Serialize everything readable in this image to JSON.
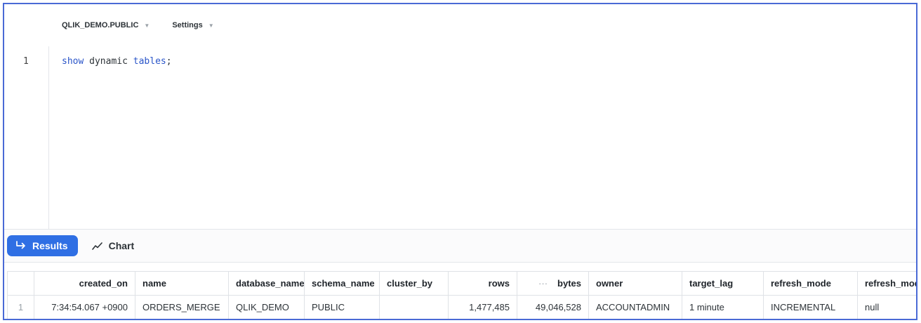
{
  "toolbar": {
    "context": "QLIK_DEMO.PUBLIC",
    "settings": "Settings"
  },
  "editor": {
    "line_number": "1",
    "tokens": {
      "show": "show",
      "dynamic": " dynamic ",
      "tables": "tables",
      "semicolon": ";"
    }
  },
  "tabs": {
    "results": "Results",
    "chart": "Chart"
  },
  "grid": {
    "columns": [
      "created_on",
      "name",
      "database_name",
      "schema_name",
      "cluster_by",
      "rows",
      "bytes",
      "owner",
      "target_lag",
      "refresh_mode",
      "refresh_mode_reason"
    ],
    "rows": [
      {
        "index": "1",
        "created_on": "7:34:54.067 +0900",
        "name": "ORDERS_MERGE",
        "database_name": "QLIK_DEMO",
        "schema_name": "PUBLIC",
        "cluster_by": "",
        "rows": "1,477,485",
        "bytes": "49,046,528",
        "owner": "ACCOUNTADMIN",
        "target_lag": "1 minute",
        "refresh_mode": "INCREMENTAL",
        "refresh_mode_reason": "null"
      }
    ]
  },
  "colors": {
    "accent": "#2f6fe4",
    "keyword": "#2a55c9",
    "frame": "#4a6ad6"
  },
  "icons": {
    "results": "arrow-return-right-icon",
    "chart": "line-chart-icon",
    "dropdown": "caret-down-icon",
    "more": "ellipsis-icon"
  }
}
